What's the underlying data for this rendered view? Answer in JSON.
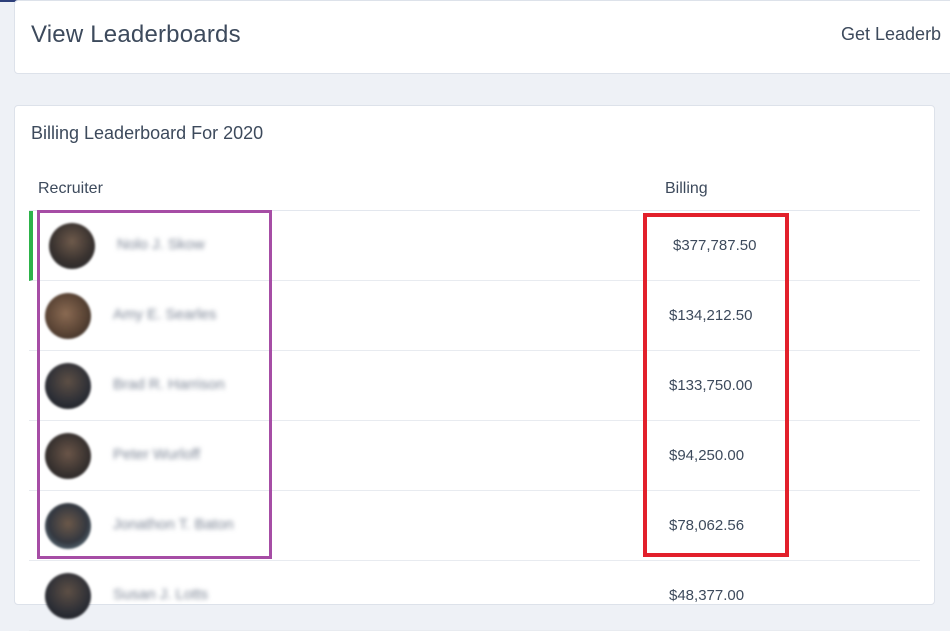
{
  "header": {
    "title": "View Leaderboards",
    "get_link": "Get Leaderb"
  },
  "leaderboard": {
    "title": "Billing Leaderboard For 2020",
    "columns": {
      "recruiter": "Recruiter",
      "billing": "Billing"
    },
    "rows": [
      {
        "name": "Nolo J. Skow",
        "billing": "$377,787.50"
      },
      {
        "name": "Amy E. Searles",
        "billing": "$134,212.50"
      },
      {
        "name": "Brad R. Harrison",
        "billing": "$133,750.00"
      },
      {
        "name": "Peter Wurloff",
        "billing": "$94,250.00"
      },
      {
        "name": "Jonathon T. Baton",
        "billing": "$78,062.56"
      },
      {
        "name": "Susan J. Lotts",
        "billing": "$48,377.00"
      }
    ]
  },
  "colors": {
    "top_rank_marker": "#2db34a",
    "annotation_purple": "#a64da5",
    "annotation_red": "#e2202b"
  }
}
